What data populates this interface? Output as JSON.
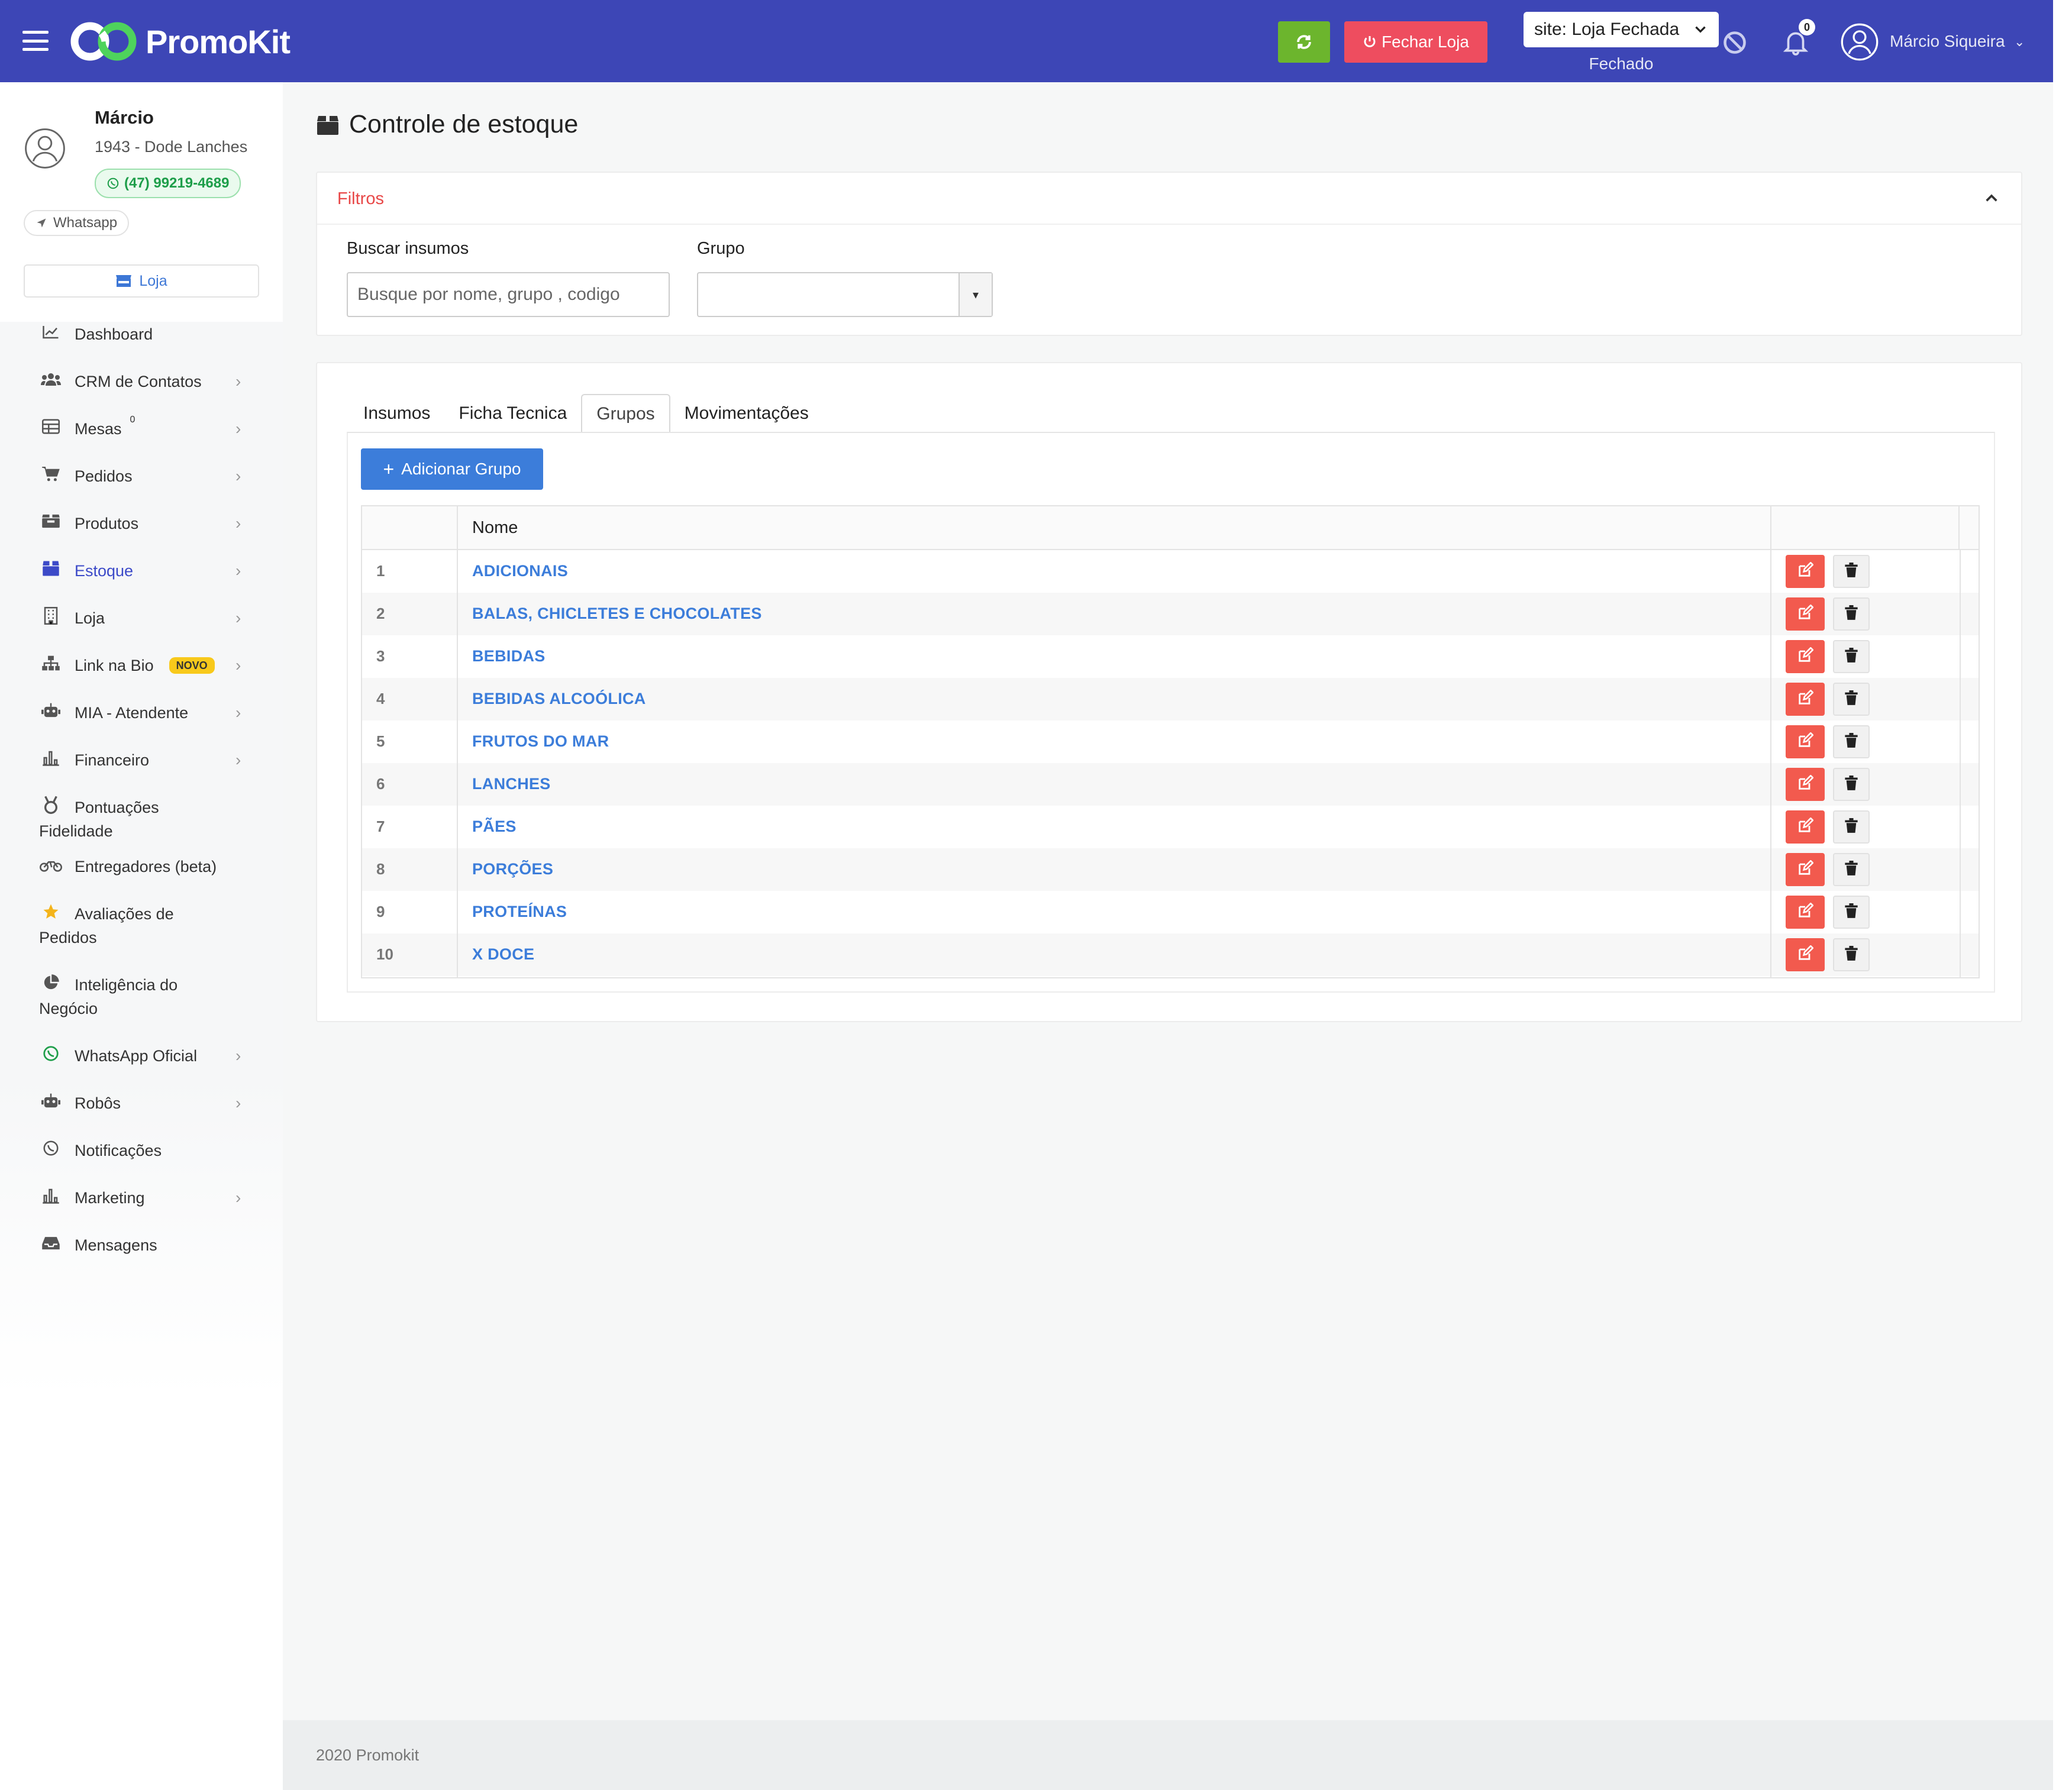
{
  "brand": {
    "name": "PromoKit",
    "topbar_color": "#3d46b6"
  },
  "topbar": {
    "close_store_label": "Fechar Loja",
    "site_select_value": "site: Loja Fechada",
    "site_status": "Fechado",
    "notifications_count": "0",
    "user_name": "Márcio Siqueira"
  },
  "profile": {
    "name": "Márcio",
    "store": "1943 - Dode Lanches",
    "phone": "(47) 99219-4689",
    "whatsapp_label": "Whatsapp",
    "store_button": "Loja"
  },
  "sidebar": {
    "items": [
      {
        "label": "Dashboard",
        "icon": "chart-line-icon",
        "chevron": false
      },
      {
        "label": "CRM de Contatos",
        "icon": "users-icon",
        "chevron": true
      },
      {
        "label": "Mesas",
        "icon": "table-icon",
        "chevron": true,
        "badge": "0"
      },
      {
        "label": "Pedidos",
        "icon": "cart-icon",
        "chevron": true
      },
      {
        "label": "Produtos",
        "icon": "boxes-icon",
        "chevron": true
      },
      {
        "label": "Estoque",
        "icon": "box-icon",
        "chevron": true,
        "active": true
      },
      {
        "label": "Loja",
        "icon": "building-icon",
        "chevron": true
      },
      {
        "label": "Link na Bio",
        "icon": "sitemap-icon",
        "chevron": true,
        "badge": "NOVO"
      },
      {
        "label": "MIA - Atendente",
        "icon": "robot-icon",
        "chevron": true
      },
      {
        "label": "Financeiro",
        "icon": "bar-chart-icon",
        "chevron": true
      },
      {
        "label": "Pontuações",
        "label2": "Fidelidade",
        "icon": "medal-icon",
        "chevron": false
      },
      {
        "label": "Entregadores (beta)",
        "icon": "motorcycle-icon",
        "chevron": false
      },
      {
        "label": "Avaliações de",
        "label2": "Pedidos",
        "icon": "star-icon",
        "chevron": false
      },
      {
        "label": "Inteligência do",
        "label2": "Negócio",
        "icon": "pie-chart-icon",
        "chevron": false
      },
      {
        "label": "WhatsApp Oficial",
        "icon": "whatsapp-icon",
        "chevron": true
      },
      {
        "label": "Robôs",
        "icon": "robot-icon",
        "chevron": true
      },
      {
        "label": "Notificações",
        "icon": "whatsapp-outline-icon",
        "chevron": false
      },
      {
        "label": "Marketing",
        "icon": "bar-chart-icon",
        "chevron": true
      },
      {
        "label": "Mensagens",
        "icon": "inbox-icon",
        "chevron": false
      }
    ]
  },
  "page": {
    "title": "Controle de estoque",
    "filters": {
      "title": "Filtros",
      "search_label": "Buscar insumos",
      "search_placeholder": "Busque por nome, grupo , codigo",
      "group_label": "Grupo",
      "group_value": ""
    },
    "tabs": [
      {
        "label": "Insumos",
        "active": false
      },
      {
        "label": "Ficha Tecnica",
        "active": false
      },
      {
        "label": "Grupos",
        "active": true
      },
      {
        "label": "Movimentações",
        "active": false
      }
    ],
    "add_button": "Adicionar Grupo",
    "table": {
      "columns": [
        "",
        "Nome",
        ""
      ],
      "rows": [
        {
          "num": "1",
          "name": "ADICIONAIS"
        },
        {
          "num": "2",
          "name": "BALAS, CHICLETES E CHOCOLATES"
        },
        {
          "num": "3",
          "name": "BEBIDAS"
        },
        {
          "num": "4",
          "name": "BEBIDAS ALCOÓLICA"
        },
        {
          "num": "5",
          "name": "FRUTOS DO MAR"
        },
        {
          "num": "6",
          "name": "LANCHES"
        },
        {
          "num": "7",
          "name": "PÃES"
        },
        {
          "num": "8",
          "name": "PORÇÕES"
        },
        {
          "num": "9",
          "name": "PROTEÍNAS"
        },
        {
          "num": "10",
          "name": "X DOCE"
        }
      ]
    }
  },
  "footer": {
    "text": "2020 Promokit"
  }
}
